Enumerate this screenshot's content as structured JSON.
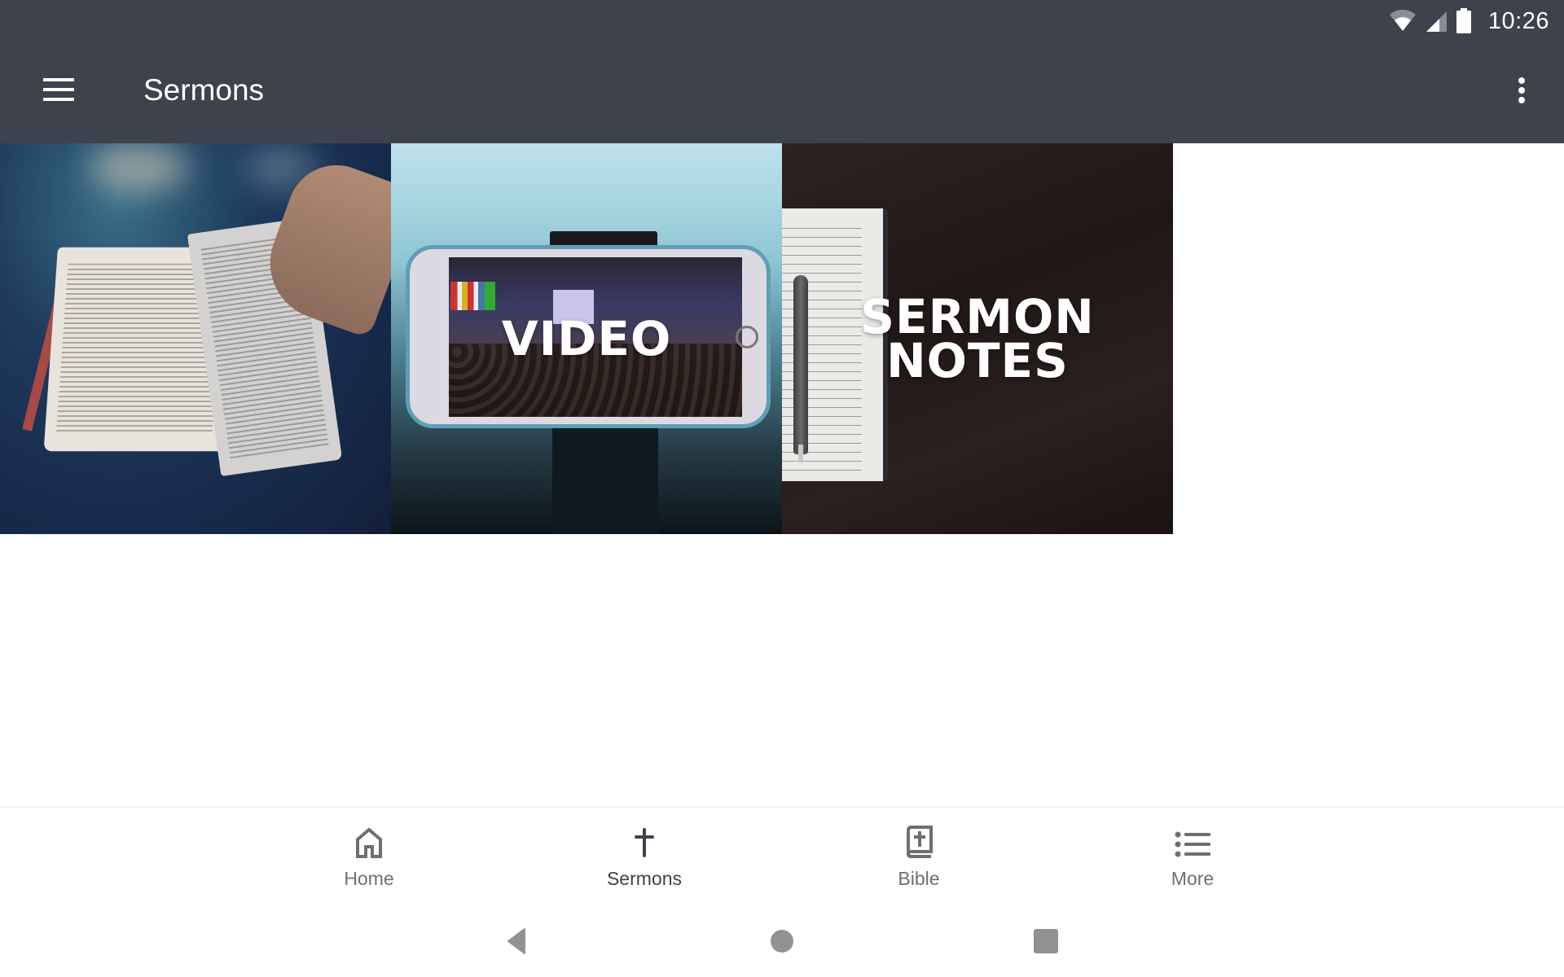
{
  "status_bar": {
    "time": "10:26",
    "icons": [
      "wifi-icon",
      "cell-signal-icon",
      "battery-icon"
    ]
  },
  "app_bar": {
    "title": "Sermons",
    "menu_icon": "hamburger-menu-icon",
    "overflow_icon": "more-vert-icon"
  },
  "tiles": [
    {
      "id": "bible",
      "label": "",
      "image": "open-bible-photo"
    },
    {
      "id": "video",
      "label": "VIDEO",
      "image": "phone-recording-church-service-photo"
    },
    {
      "id": "notes",
      "label": "SERMON\nNOTES",
      "image": "notebook-and-pen-on-wood-photo"
    }
  ],
  "bottom_nav": {
    "active": "Sermons",
    "items": [
      {
        "label": "Home",
        "icon": "home-icon"
      },
      {
        "label": "Sermons",
        "icon": "cross-icon"
      },
      {
        "label": "Bible",
        "icon": "bible-icon"
      },
      {
        "label": "More",
        "icon": "list-icon"
      }
    ]
  },
  "system_nav": {
    "buttons": [
      "back-icon",
      "home-circle-icon",
      "recents-square-icon"
    ]
  },
  "colors": {
    "app_bar": "#3d424d",
    "nav_active": "#3d424d",
    "nav_inactive": "#6f6f6f",
    "system_nav_icons": "#929292"
  }
}
